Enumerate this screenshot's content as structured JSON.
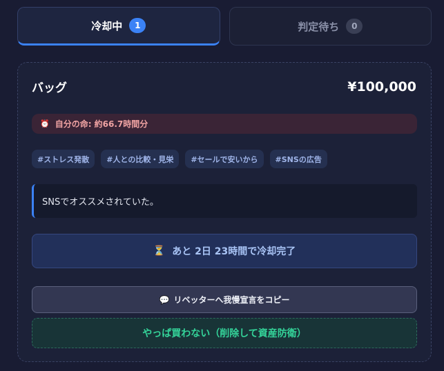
{
  "tabs": [
    {
      "label": "冷却中",
      "count": "1"
    },
    {
      "label": "判定待ち",
      "count": "0"
    }
  ],
  "item": {
    "name": "バッグ",
    "price": "¥100,000",
    "life_icon": "⏰",
    "life_text": "自分の命: 約66.7時間分",
    "tags": [
      "#ストレス発散",
      "#人との比較・見栄",
      "#セールで安いから",
      "#SNSの広告"
    ],
    "memo": "SNSでオススメされていた。",
    "cooldown_icon": "⏳",
    "cooldown_text": "あと 2日 23時間で冷却完了",
    "copy_icon": "💬",
    "copy_label": "リベッターへ我慢宣言をコピー",
    "delete_label": "やっぱ買わない（削除して資産防衛）"
  },
  "colors": {
    "accent": "#3b82f6",
    "danger_text": "#f0a3a3",
    "success": "#34d399"
  }
}
